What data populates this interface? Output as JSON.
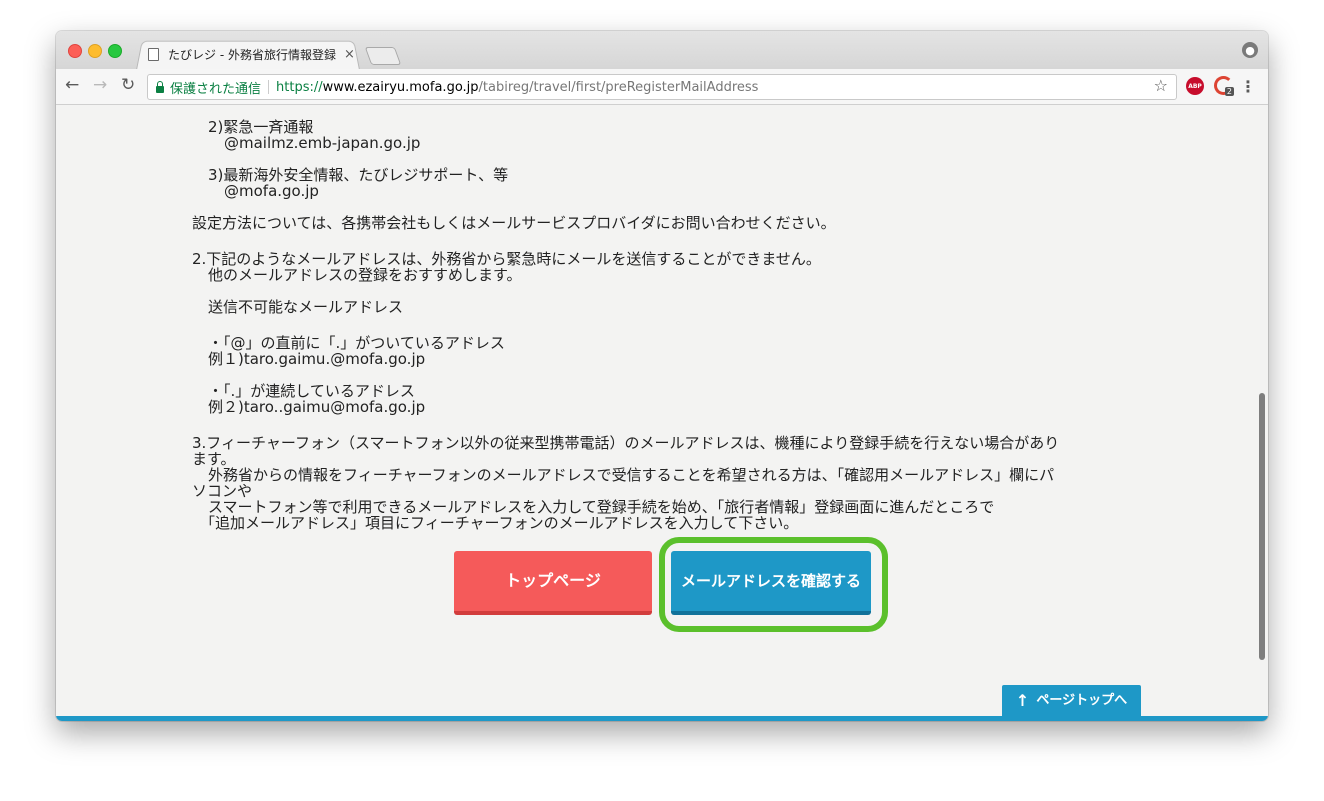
{
  "browser": {
    "tab_title": "たびレジ - 外務省旅行情報登録",
    "tab_close": "×",
    "secure_label": "保護された通信",
    "url_scheme": "https://",
    "url_host": "www.ezairyu.mofa.go.jp",
    "url_path": "/tabireg/travel/first/preRegisterMailAddress",
    "abp_label": "ABP",
    "ext_badge": "2"
  },
  "content": {
    "item2_title": "2)緊急一斉通報",
    "item2_domain": "@mailmz.emb-japan.go.jp",
    "item3_title": "3)最新海外安全情報、たびレジサポート、等",
    "item3_domain": "@mofa.go.jp",
    "setup_note": "設定方法については、各携帯会社もしくはメールサービスプロバイダにお問い合わせください。",
    "note2_line1": "2.下記のようなメールアドレスは、外務省から緊急時にメールを送信することができません。",
    "note2_line2": "他のメールアドレスの登録をおすすめします。",
    "unsendable_heading": "送信不可能なメールアドレス",
    "case1": "・「@」の直前に「.」がついているアドレス",
    "example1": "例１)taro.gaimu.@mofa.go.jp",
    "case2": "・「.」が連続しているアドレス",
    "example2": "例２)taro..gaimu@mofa.go.jp",
    "note3_line1": "3.フィーチャーフォン（スマートフォン以外の従来型携帯電話）のメールアドレスは、機種により登録手続を行えない場合があり",
    "note3_line2": "ます。",
    "note3_line3": "外務省からの情報をフィーチャーフォンのメールアドレスで受信することを希望される方は、「確認用メールアドレス」欄にパ",
    "note3_line4": "ソコンや",
    "note3_line5": "スマートフォン等で利用できるメールアドレスを入力して登録手続を始め、「旅行者情報」登録画面に進んだところで",
    "note3_line6": "「追加メールアドレス」項目にフィーチャーフォンのメールアドレスを入力して下さい。"
  },
  "buttons": {
    "top_page": "トップページ",
    "confirm_email": "メールアドレスを確認する",
    "page_top": "ページトップへ"
  },
  "colors": {
    "top_page_button": "#f55a5a",
    "confirm_button": "#1e98c7",
    "highlight_ring": "#5bc02c",
    "secure_green": "#0b8043"
  },
  "icons": {
    "page_top_arrow": "↑",
    "back": "←",
    "forward": "→",
    "reload": "↻",
    "star": "☆",
    "menu": "⋮",
    "profile": "●"
  }
}
